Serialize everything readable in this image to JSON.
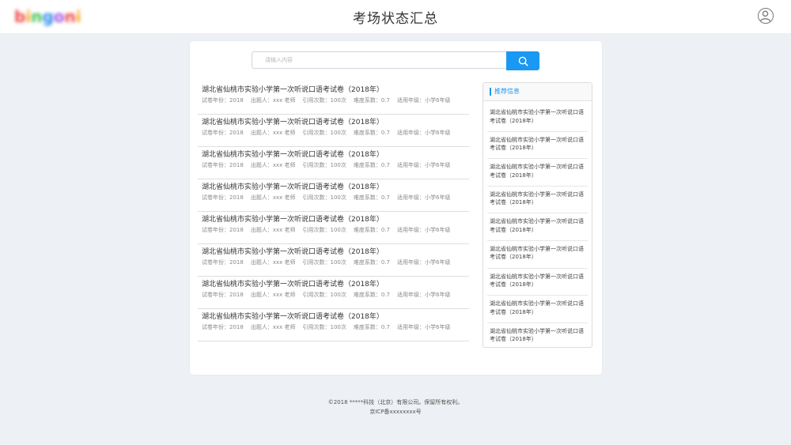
{
  "header": {
    "logo_letters": [
      "b",
      "i",
      "n",
      "g",
      "o",
      "n",
      "i"
    ],
    "logo_colors": [
      "#f04848",
      "#f7a51c",
      "#3cc24f",
      "#2f8cf0",
      "#a257e8",
      "#f04848",
      "#f7a51c"
    ],
    "title": "考场状态汇总",
    "avatar_icon": "user-avatar-icon"
  },
  "search": {
    "placeholder": "请输入内容",
    "button_icon": "search-icon",
    "accent": "#1a98f3"
  },
  "papers": [
    {
      "title": "湖北省仙桃市实验小学第一次听说口语考试卷（2018年）",
      "year": "试卷年份：2018",
      "author": "出题人：xxx 老师",
      "cites": "引用次数：100次",
      "difficulty": "难度系数：0.7",
      "grade": "适用年级：小学6年级"
    },
    {
      "title": "湖北省仙桃市实验小学第一次听说口语考试卷（2018年）",
      "year": "试卷年份：2018",
      "author": "出题人：xxx 老师",
      "cites": "引用次数：100次",
      "difficulty": "难度系数：0.7",
      "grade": "适用年级：小学6年级"
    },
    {
      "title": "湖北省仙桃市实验小学第一次听说口语考试卷（2018年）",
      "year": "试卷年份：2018",
      "author": "出题人：xxx 老师",
      "cites": "引用次数：100次",
      "difficulty": "难度系数：0.7",
      "grade": "适用年级：小学6年级"
    },
    {
      "title": "湖北省仙桃市实验小学第一次听说口语考试卷（2018年）",
      "year": "试卷年份：2018",
      "author": "出题人：xxx 老师",
      "cites": "引用次数：100次",
      "difficulty": "难度系数：0.7",
      "grade": "适用年级：小学6年级"
    },
    {
      "title": "湖北省仙桃市实验小学第一次听说口语考试卷（2018年）",
      "year": "试卷年份：2018",
      "author": "出题人：xxx 老师",
      "cites": "引用次数：100次",
      "difficulty": "难度系数：0.7",
      "grade": "适用年级：小学6年级"
    },
    {
      "title": "湖北省仙桃市实验小学第一次听说口语考试卷（2018年）",
      "year": "试卷年份：2018",
      "author": "出题人：xxx 老师",
      "cites": "引用次数：100次",
      "difficulty": "难度系数：0.7",
      "grade": "适用年级：小学6年级"
    },
    {
      "title": "湖北省仙桃市实验小学第一次听说口语考试卷（2018年）",
      "year": "试卷年份：2018",
      "author": "出题人：xxx 老师",
      "cites": "引用次数：100次",
      "difficulty": "难度系数：0.7",
      "grade": "适用年级：小学6年级"
    },
    {
      "title": "湖北省仙桃市实验小学第一次听说口语考试卷（2018年）",
      "year": "试卷年份：2018",
      "author": "出题人：xxx 老师",
      "cites": "引用次数：100次",
      "difficulty": "难度系数：0.7",
      "grade": "适用年级：小学6年级"
    }
  ],
  "recommend": {
    "title": "推荐信息",
    "items": [
      {
        "line1": "湖北省仙桃市实验小学第一次听说口语",
        "line2": "考试卷（2018年）"
      },
      {
        "line1": "湖北省仙桃市实验小学第一次听说口语",
        "line2": "考试卷（2018年）"
      },
      {
        "line1": "湖北省仙桃市实验小学第一次听说口语",
        "line2": "考试卷（2018年）"
      },
      {
        "line1": "湖北省仙桃市实验小学第一次听说口语",
        "line2": "考试卷（2018年）"
      },
      {
        "line1": "湖北省仙桃市实验小学第一次听说口语",
        "line2": "考试卷（2018年）"
      },
      {
        "line1": "湖北省仙桃市实验小学第一次听说口语",
        "line2": "考试卷（2018年）"
      },
      {
        "line1": "湖北省仙桃市实验小学第一次听说口语",
        "line2": "考试卷（2018年）"
      },
      {
        "line1": "湖北省仙桃市实验小学第一次听说口语",
        "line2": "考试卷（2018年）"
      },
      {
        "line1": "湖北省仙桃市实验小学第一次听说口语",
        "line2": "考试卷（2018年）"
      }
    ]
  },
  "footer": {
    "copyright": "©2018 *****科技（北京）有限公司。保留所有权利。",
    "icp": "京ICP备xxxxxxxx号"
  }
}
